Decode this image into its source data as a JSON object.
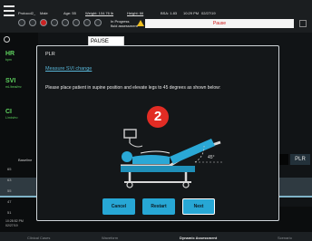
{
  "patient_bar": {
    "name": "Protocol2_",
    "sex": "Male",
    "age": "Age: 55",
    "weight": "Weight: 104.76 lb",
    "height": "Height: 66",
    "bsa": "BSA: 1.83",
    "time": "10:29 PM",
    "date": "02/27/19"
  },
  "status": {
    "progress_line1": "In Progress",
    "progress_line2": "fluid assessment",
    "pause_banner": "Pause"
  },
  "left_params": [
    {
      "label": "HR",
      "unit": "bpm"
    },
    {
      "label": "SVI",
      "unit": "mL/beat/m²"
    },
    {
      "label": "CI",
      "unit": "L/min/m²"
    }
  ],
  "background": {
    "pause_label": "PAUSE",
    "baseline_label": "Baseline",
    "y_ticks": [
      "65",
      "63",
      "55",
      "47",
      "51"
    ],
    "time_label": "10:28:52 PM",
    "date_label": "02/27/19",
    "plr_tab": "PLR",
    "bottom_tabs": [
      "Clinical Cases",
      "Waveform",
      "Dynamic Assessment",
      "Scenario"
    ]
  },
  "dialog": {
    "title": "PLR",
    "link": "Measure SVI change",
    "instruction": "Please place patient in supine position and elevate legs to 45 degrees as shown below:",
    "step_number": "2",
    "angle_label": "45°",
    "buttons": {
      "cancel": "Cancel",
      "restart": "Restart",
      "next": "Next"
    }
  },
  "colors": {
    "accent": "#27a7d5",
    "param_green": "#5fd35f",
    "step_red": "#e22c24",
    "link_blue": "#58b6d8"
  }
}
